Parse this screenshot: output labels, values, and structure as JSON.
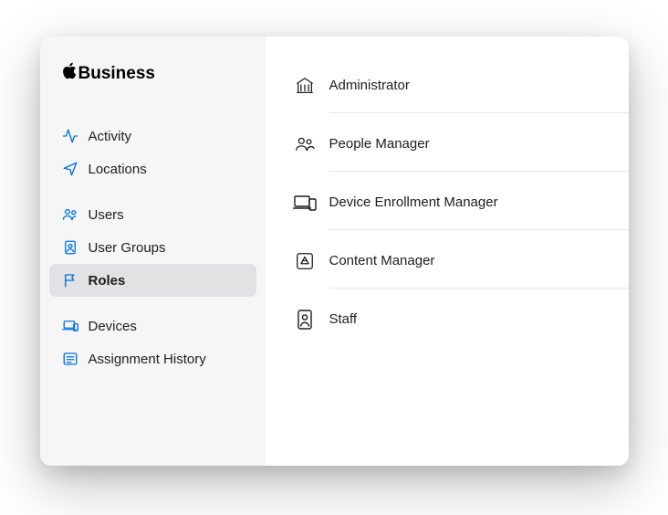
{
  "brand": "Business",
  "sidebar": {
    "group1": [
      {
        "label": "Activity",
        "key": "activity"
      },
      {
        "label": "Locations",
        "key": "locations"
      }
    ],
    "group2": [
      {
        "label": "Users",
        "key": "users"
      },
      {
        "label": "User Groups",
        "key": "user-groups"
      },
      {
        "label": "Roles",
        "key": "roles",
        "active": true
      }
    ],
    "group3": [
      {
        "label": "Devices",
        "key": "devices"
      },
      {
        "label": "Assignment History",
        "key": "assignment-history"
      }
    ]
  },
  "roles": [
    {
      "label": "Administrator",
      "key": "administrator"
    },
    {
      "label": "People Manager",
      "key": "people-manager"
    },
    {
      "label": "Device Enrollment Manager",
      "key": "device-enrollment-manager"
    },
    {
      "label": "Content Manager",
      "key": "content-manager"
    },
    {
      "label": "Staff",
      "key": "staff"
    }
  ]
}
